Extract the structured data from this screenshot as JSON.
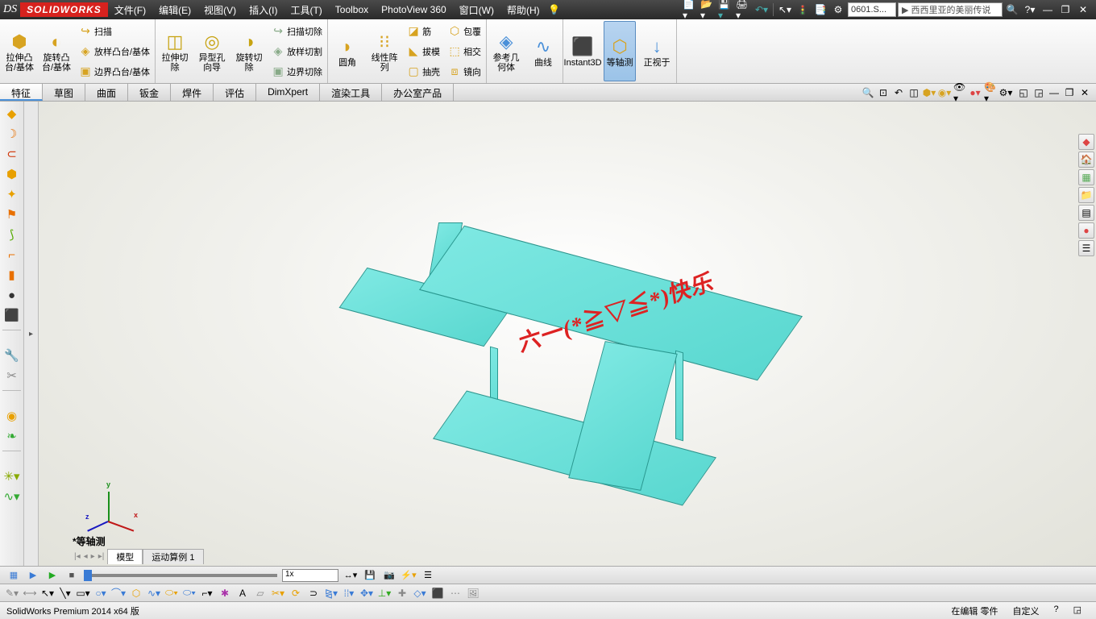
{
  "title_bar": {
    "logo_prefix": "DS",
    "logo": "SOLIDWORKS",
    "menus": [
      "文件(F)",
      "编辑(E)",
      "视图(V)",
      "插入(I)",
      "工具(T)",
      "Toolbox",
      "PhotoView 360",
      "窗口(W)",
      "帮助(H)"
    ],
    "doc_name": "0601.S...",
    "search_text": "西西里亚的美丽传说"
  },
  "ribbon": {
    "big": {
      "extrude": "拉伸凸\n台/基体",
      "revolve": "旋转凸\n台/基体",
      "cut_extrude": "拉伸切\n除",
      "hole": "异型孔\n向导",
      "rev_cut": "旋转切\n除",
      "fillet": "圆角",
      "pattern": "线性阵\n列",
      "ref_geo": "参考几\n何体",
      "curves": "曲线",
      "instant3d": "Instant3D",
      "iso_view": "等轴测",
      "normal_to": "正视于"
    },
    "small": {
      "sweep": "扫描",
      "loft": "放样凸台/基体",
      "boundary": "边界凸台/基体",
      "sweep_cut": "扫描切除",
      "loft_cut": "放样切割",
      "boundary_cut": "边界切除",
      "rib": "筋",
      "draft": "拔模",
      "shell": "抽壳",
      "wrap": "包覆",
      "intersect": "相交",
      "mirror": "镜向"
    }
  },
  "tabs": [
    "特征",
    "草图",
    "曲面",
    "钣金",
    "焊件",
    "评估",
    "DimXpert",
    "渲染工具",
    "办公室产品"
  ],
  "viewport": {
    "view_label": "*等轴测",
    "model_text": "六一(*≧▽≦*)快乐",
    "axes": {
      "x": "x",
      "y": "y",
      "z": "z"
    }
  },
  "model_tabs": [
    "模型",
    "运动算例 1"
  ],
  "timeline": {
    "speed": "1x"
  },
  "status": {
    "left": "SolidWorks Premium 2014 x64 版",
    "editing": "在编辑 零件",
    "custom": "自定义"
  }
}
